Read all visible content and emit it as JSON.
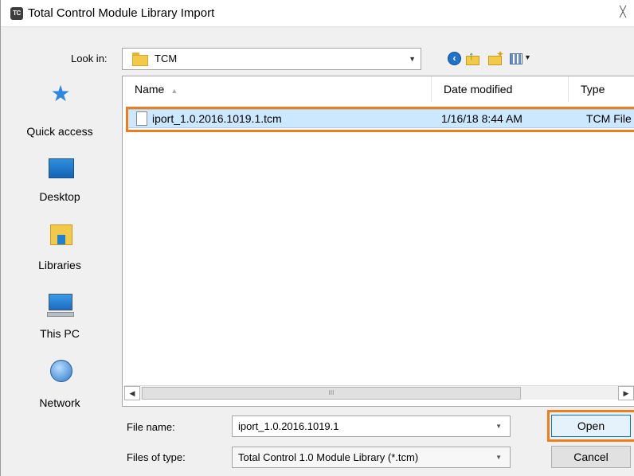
{
  "window": {
    "icon_text": "TC",
    "title": "Total Control Module Library Import",
    "close_glyph": "╳"
  },
  "lookin": {
    "label": "Look in:",
    "value": "TCM"
  },
  "places": [
    {
      "label": "Quick access",
      "icon": "star-icon"
    },
    {
      "label": "Desktop",
      "icon": "desktop-icon"
    },
    {
      "label": "Libraries",
      "icon": "libraries-icon"
    },
    {
      "label": "This PC",
      "icon": "computer-icon"
    },
    {
      "label": "Network",
      "icon": "network-icon"
    }
  ],
  "filelist": {
    "columns": [
      "Name",
      "Date modified",
      "Type"
    ],
    "rows": [
      {
        "name": "iport_1.0.2016.1019.1.tcm",
        "date": "1/16/18 8:44 AM",
        "type": "TCM File",
        "selected": true
      }
    ]
  },
  "scrollbar": {
    "left_arrow": "◀",
    "right_arrow": "▶",
    "grip": "III"
  },
  "filename": {
    "label": "File name:",
    "value": "iport_1.0.2016.1019.1"
  },
  "filetype": {
    "label": "Files of type:",
    "value": "Total Control 1.0 Module Library (*.tcm)"
  },
  "buttons": {
    "open": "Open",
    "cancel": "Cancel"
  },
  "colors": {
    "highlight": "#f07d1a",
    "selection": "#cce8ff"
  }
}
